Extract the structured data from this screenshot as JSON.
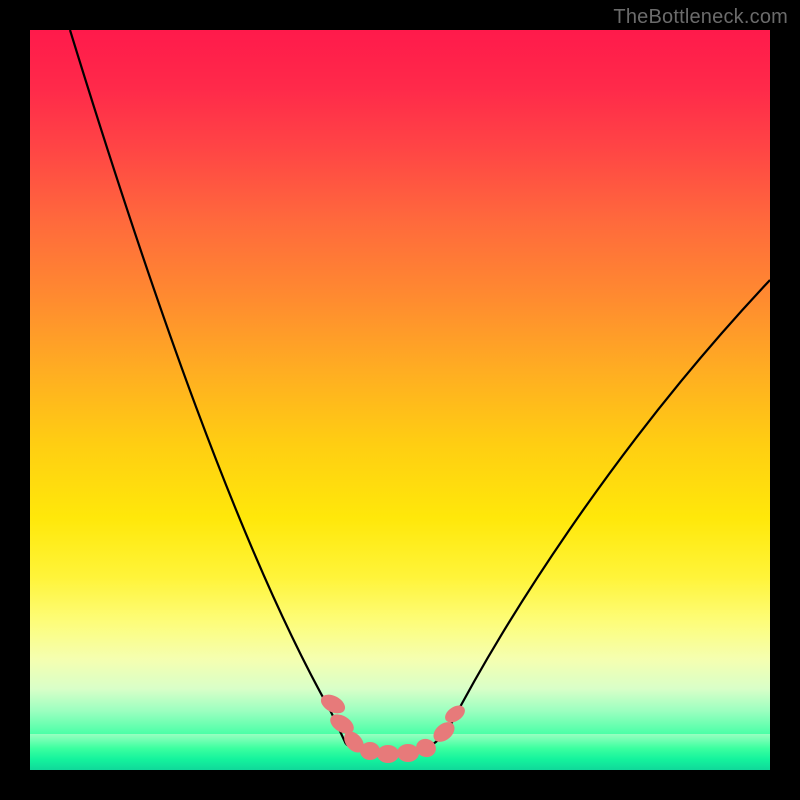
{
  "attribution": "TheBottleneck.com",
  "colors": {
    "background": "#000000",
    "curve": "#000000",
    "marker": "#e77a7a",
    "attribution": "#6b6b6b",
    "gradient_top": "#ff1a4b",
    "gradient_bottom": "#13e49a"
  },
  "chart_data": {
    "type": "line",
    "title": "",
    "xlabel": "",
    "ylabel": "",
    "xlim": [
      0,
      100
    ],
    "ylim": [
      0,
      100
    ],
    "grid": false,
    "legend": false,
    "series": [
      {
        "name": "bottleneck-curve",
        "x": [
          5,
          10,
          15,
          20,
          25,
          30,
          35,
          40,
          42,
          44,
          46,
          48,
          50,
          52,
          54,
          56,
          60,
          65,
          70,
          75,
          80,
          85,
          90,
          95,
          100
        ],
        "y": [
          100,
          90,
          80,
          70,
          59,
          48,
          36,
          20,
          12,
          6,
          3,
          2,
          2,
          2,
          3,
          6,
          13,
          22,
          30,
          37,
          44,
          50,
          56,
          62,
          67
        ]
      }
    ],
    "markers": [
      {
        "x": 41.5,
        "y": 10
      },
      {
        "x": 42.5,
        "y": 7
      },
      {
        "x": 44.5,
        "y": 4
      },
      {
        "x": 46.5,
        "y": 3
      },
      {
        "x": 48.5,
        "y": 2.5
      },
      {
        "x": 50.5,
        "y": 2.5
      },
      {
        "x": 52.5,
        "y": 3
      },
      {
        "x": 55.5,
        "y": 6
      },
      {
        "x": 56.5,
        "y": 8
      }
    ],
    "annotations": []
  }
}
